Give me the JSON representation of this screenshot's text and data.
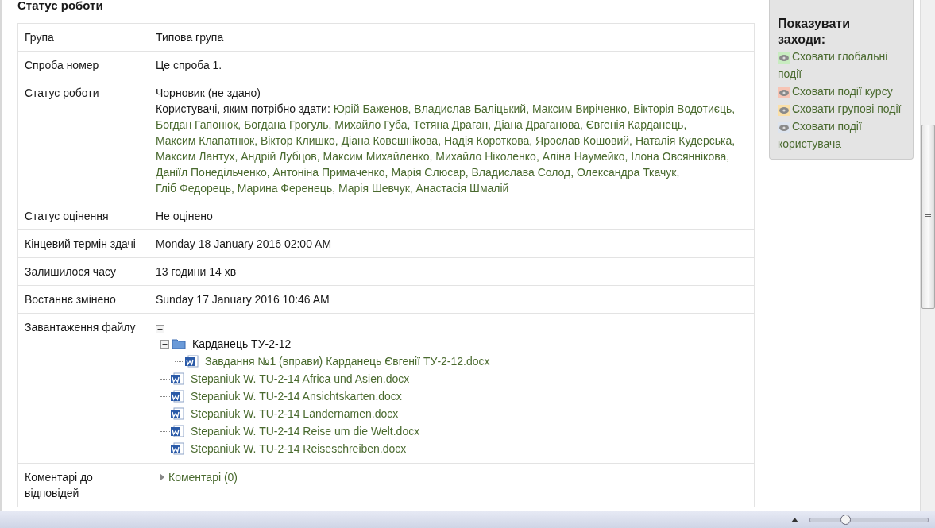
{
  "heading": "Статус роботи",
  "rows": [
    {
      "kind": "text",
      "label": "Група",
      "value": "Типова група"
    },
    {
      "kind": "text",
      "label": "Спроба номер",
      "value": "Це спроба 1."
    },
    {
      "kind": "status",
      "label": "Статус роботи",
      "value": "Чорновик (не здано)",
      "users_label": "Користувачі, яким потрібно здати:",
      "users": [
        "Юрій Баженов,",
        "Владислав Баліцький,",
        "Максим Виріченко,",
        "Вікторія Водотиєць,",
        "Богдан Гапонюк,",
        "Богдана Грогуль,",
        "Михайло Губа,",
        "Тетяна Драган,",
        "Діана Драганова,",
        "Євгенія Карданець,",
        "Максим Клапатнюк,",
        "Віктор Клишко,",
        "Діана Ковєшнікова,",
        "Надія Короткова,",
        "Ярослав Кошовий,",
        "Наталія Кудерська,",
        "Максим Лантух,",
        "Андрій Лубцов,",
        "Максим Михайленко,",
        "Михайло Ніколенко,",
        "Аліна Наумейко,",
        "Ілона Овсяннікова,",
        "Даніїл Понедільченко,",
        "Антоніна Примаченко,",
        "Марія Слюсар,",
        "Владислава Солод,",
        "Олександра Ткачук,",
        "Гліб Федорець,",
        "Марина Ференець,",
        "Марія Шевчук,",
        "Анастасія Шмалій"
      ]
    },
    {
      "kind": "text",
      "label": "Статус оцінення",
      "value": "Не оцінено"
    },
    {
      "kind": "text",
      "label": "Кінцевий термін здачі",
      "value": "Monday 18 January 2016 02:00 AM"
    },
    {
      "kind": "text",
      "label": "Залишилося часу",
      "value": "13 години 14 хв"
    },
    {
      "kind": "text",
      "label": "Востаннє змінено",
      "value": "Sunday 17 January 2016 10:46 AM"
    },
    {
      "kind": "files",
      "label": "Завантаження файлу",
      "expanded": true,
      "tree": [
        {
          "kind": "folder",
          "name": "Карданець ТУ-2-12",
          "expanded": true,
          "children": [
            {
              "kind": "file",
              "name": "Завдання №1 (вправи) Карданець Євгенії ТУ-2-12.docx"
            }
          ]
        },
        {
          "kind": "file",
          "name": "Stepaniuk W. TU-2-14 Africa und Asien.docx"
        },
        {
          "kind": "file",
          "name": "Stepaniuk W. TU-2-14 Ansichtskarten.docx"
        },
        {
          "kind": "file",
          "name": "Stepaniuk W. TU-2-14 Ländernamen.docx"
        },
        {
          "kind": "file",
          "name": "Stepaniuk W. TU-2-14 Reise um die Welt.docx"
        },
        {
          "kind": "file",
          "name": "Stepaniuk W. TU-2-14 Reiseschreiben.docx"
        }
      ]
    },
    {
      "kind": "comments",
      "label": "Коментарі до відповідей",
      "link": "Коментарі (0)",
      "expanded": false
    }
  ],
  "sidebar": {
    "title": "Показувати заходи:",
    "events": [
      {
        "label": "Сховати глобальні події",
        "color": "#c8ecc0"
      },
      {
        "label": "Сховати події курсу",
        "color": "#f7c4b4"
      },
      {
        "label": "Сховати групові події",
        "color": "#fbe0a8"
      },
      {
        "label": "Сховати події користувача",
        "color": "#dde4ee"
      }
    ]
  },
  "status_bar": {
    "zoom": {
      "level": 0.3
    }
  }
}
